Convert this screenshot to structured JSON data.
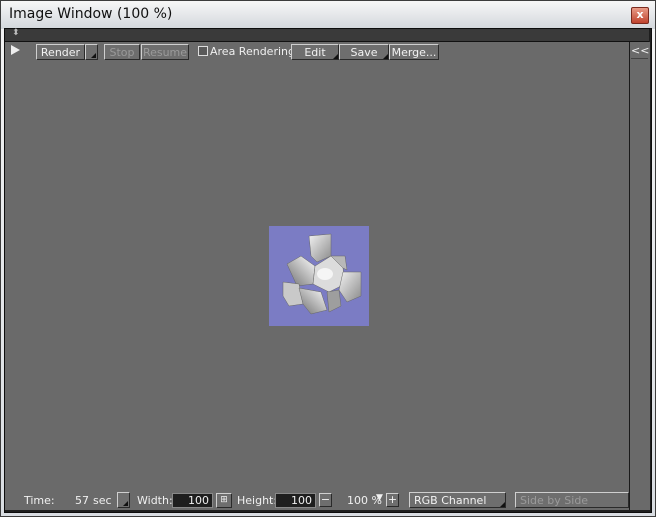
{
  "window": {
    "title": "Image Window (100 %)",
    "close_symbol": "x"
  },
  "toolbar": {
    "render": "Render",
    "stop": "Stop",
    "resume": "Resume",
    "area_rendering": "Area Rendering",
    "area_rendering_checked": false,
    "edit": "Edit",
    "save": "Save",
    "merge": "Merge...",
    "collapse": "<<"
  },
  "canvas": {
    "background_color": "#6a6a6a",
    "render_background": "#7b7cc4",
    "object": "white 3D geometric mesh render"
  },
  "statusbar": {
    "time_label": "Time:",
    "time_value": "57",
    "time_unit": "sec",
    "width_label": "Width:",
    "width_value": "100",
    "height_label": "Height:",
    "height_value": "100",
    "zoom_minus": "−",
    "zoom_value": "100 %",
    "zoom_plus": "+",
    "channel": "RGB Channel",
    "side_by_side": "Side by Side"
  }
}
